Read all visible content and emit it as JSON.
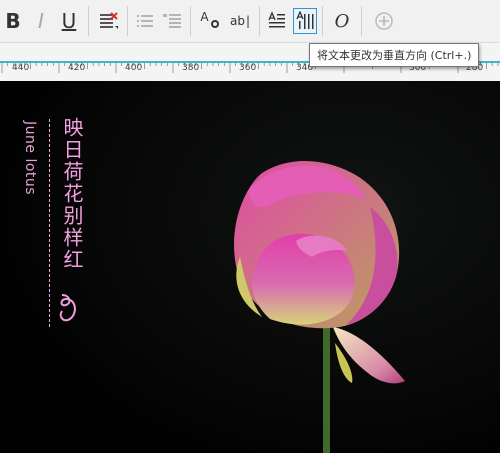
{
  "toolbar": {
    "bold_label": "B",
    "italic_label": "I",
    "underline_label": "U",
    "text_size_label": "A",
    "replace_label": "ab",
    "vertical_label": "A",
    "font_label": "O"
  },
  "tooltip": {
    "text": "将文本更改为垂直方向 (Ctrl+.)"
  },
  "ruler": {
    "labels": [
      "440",
      "420",
      "400",
      "380",
      "360",
      "340",
      "300",
      "280"
    ]
  },
  "canvas": {
    "title_cn": "映日荷花别样红",
    "subtitle_en": "June lotus"
  },
  "colors": {
    "accent": "#f39fe1",
    "ruler_line": "#39b6c9",
    "background": "#030303"
  }
}
